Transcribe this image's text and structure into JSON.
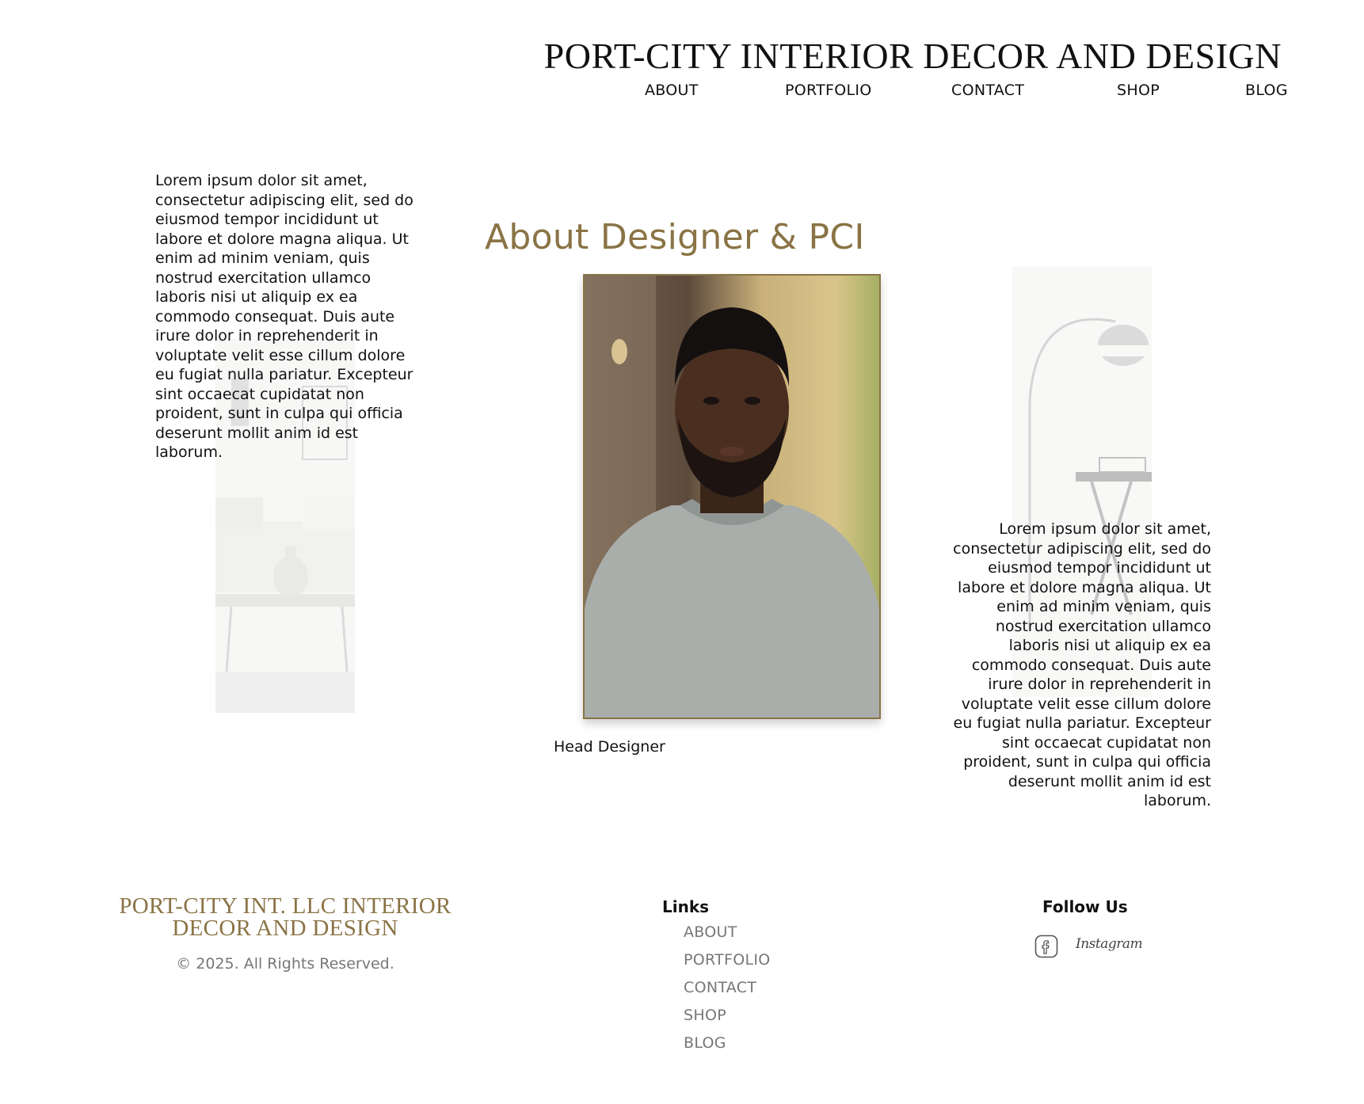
{
  "header": {
    "brand": "PORT-CITY INTERIOR DECOR AND DESIGN",
    "nav": [
      "ABOUT",
      "PORTFOLIO",
      "CONTACT",
      "SHOP",
      "BLOG"
    ]
  },
  "main": {
    "title": "About Designer & PCI",
    "left_paragraph": "Lorem ipsum dolor sit amet, consectetur adipiscing elit, sed do eiusmod tempor incididunt ut labore et dolore magna aliqua. Ut enim ad minim veniam, quis nostrud exercitation ullamco laboris nisi ut aliquip ex ea commodo consequat. Duis aute irure dolor in reprehenderit in voluptate velit esse cillum dolore eu fugiat nulla pariatur. Excepteur sint occaecat cupidatat non proident, sunt in culpa qui officia deserunt mollit anim id est laborum.",
    "right_paragraph": "Lorem ipsum dolor sit amet, consectetur adipiscing elit, sed do eiusmod tempor incididunt ut labore et dolore magna aliqua. Ut enim ad minim veniam, quis nostrud exercitation ullamco laboris nisi ut aliquip ex ea commodo consequat. Duis aute irure dolor in reprehenderit in voluptate velit esse cillum dolore eu fugiat nulla pariatur. Excepteur sint occaecat cupidatat non proident, sunt in culpa qui officia deserunt mollit anim id est laborum.",
    "caption": "Head Designer"
  },
  "footer": {
    "brand": "PORT-CITY INT. LLC INTERIOR DECOR AND DESIGN",
    "copyright": "© 2025. All Rights Reserved.",
    "links_title": "Links",
    "links": [
      "ABOUT",
      "PORTFOLIO",
      "CONTACT",
      "SHOP",
      "BLOG"
    ],
    "follow_title": "Follow Us",
    "social": {
      "facebook_icon": "facebook-icon",
      "instagram": "Instagram"
    }
  },
  "colors": {
    "accent": "#8a7345",
    "text": "#111111",
    "muted": "#777777"
  }
}
